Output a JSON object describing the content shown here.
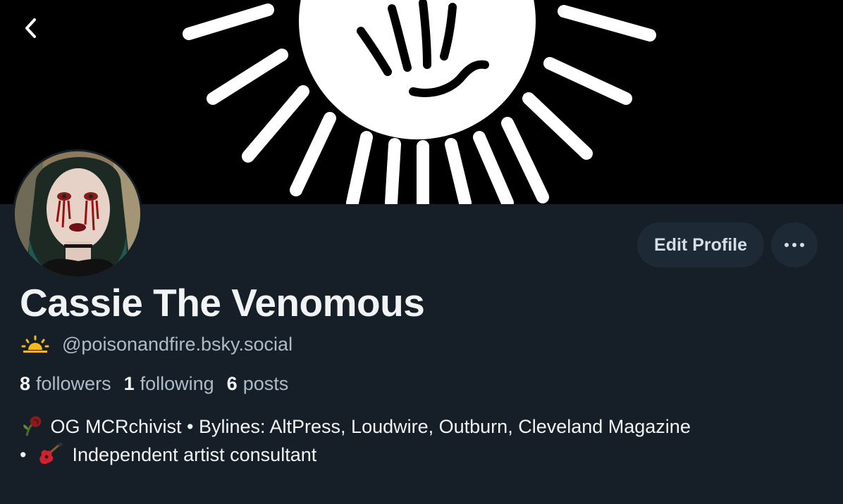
{
  "profile": {
    "display_name": "Cassie The Venomous",
    "handle": "@poisonandfire.bsky.social",
    "handle_icon": "sunrise-icon",
    "stats": [
      {
        "count": "8",
        "label": "followers"
      },
      {
        "count": "1",
        "label": "following"
      },
      {
        "count": "6",
        "label": "posts"
      }
    ],
    "bio_line1": "OG MCRchivist • Bylines: AltPress, Loudwire, Outburn, Cleveland Magazine",
    "bio_line2_prefix": "•",
    "bio_line2": "Independent artist consultant",
    "bio_icons": [
      "wilted-rose-icon",
      "guitar-icon"
    ]
  },
  "actions": {
    "edit_label": "Edit Profile",
    "more_icon": "ellipsis-icon"
  },
  "nav": {
    "back_icon": "chevron-left-icon"
  },
  "colors": {
    "background": "#161e27",
    "button_bg": "#1e2936",
    "muted_text": "#aebbc9",
    "primary_text": "#f1f3f5",
    "banner_bg": "#000000",
    "banner_art": "#ffffff"
  }
}
